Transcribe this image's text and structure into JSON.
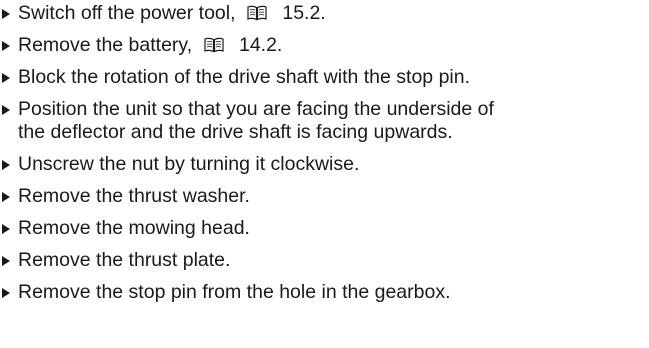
{
  "steps": [
    {
      "text": "Switch off the power tool,",
      "ref": "15.2."
    },
    {
      "text": "Remove the battery,",
      "ref": "14.2."
    },
    {
      "text": "Block the rotation of the drive shaft with the stop pin."
    },
    {
      "line1": "Position the unit so that you are facing the underside of",
      "line2": "the deflector and the drive shaft is facing upwards."
    },
    {
      "text": "Unscrew the nut by turning it clockwise."
    },
    {
      "text": "Remove the thrust washer."
    },
    {
      "text": "Remove the mowing head."
    },
    {
      "text": "Remove the thrust plate."
    },
    {
      "text": "Remove the stop pin from the hole in the gearbox."
    }
  ],
  "icons": {
    "bullet": "triangle-right-icon",
    "reference": "book-icon"
  }
}
